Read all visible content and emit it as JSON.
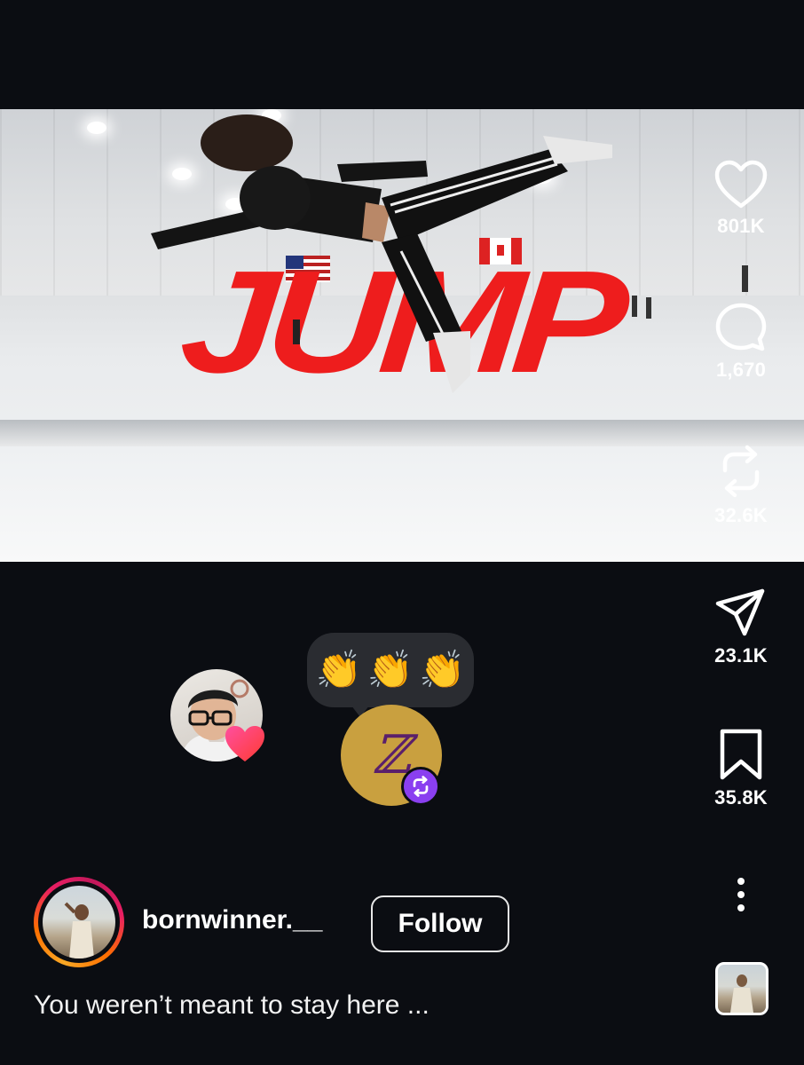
{
  "video": {
    "overlay_text": "JUMP"
  },
  "actions": {
    "likes": "801K",
    "comments": "1,670",
    "reposts": "32.6K",
    "shares": "23.1K",
    "saves": "35.8K"
  },
  "reaction_bubble": {
    "emojis": [
      "👏",
      "👏",
      "👏"
    ]
  },
  "remixer_avatar": {
    "glyph": "ℤ"
  },
  "author": {
    "username": "bornwinner.__",
    "follow_label": "Follow",
    "caption": "You weren’t meant to stay here ..."
  },
  "colors": {
    "background": "#0b0d12",
    "jump_red": "#ee1d1d",
    "repost_purple": "#8a3ff0",
    "story_ring": [
      "#f9a825",
      "#e91e63"
    ]
  }
}
